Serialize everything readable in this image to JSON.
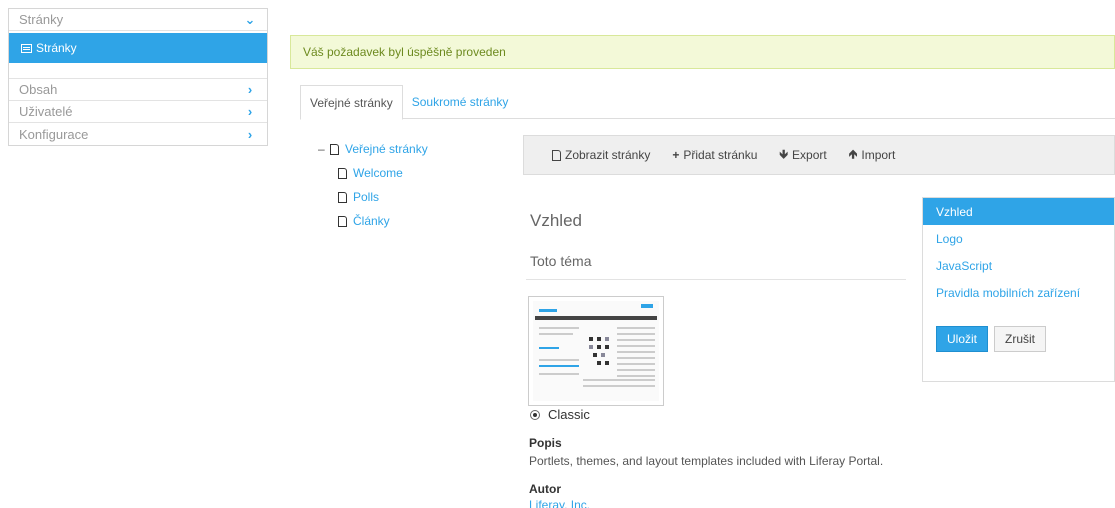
{
  "sidebar": {
    "sections": [
      {
        "label": "Stránky",
        "icon": "chevron-down-icon"
      },
      {
        "label": "Obsah",
        "icon": "chevron-right-icon"
      },
      {
        "label": "Uživatelé",
        "icon": "chevron-right-icon"
      },
      {
        "label": "Konfigurace",
        "icon": "chevron-right-icon"
      }
    ],
    "active_sub_item": "Stránky"
  },
  "alert": {
    "message": "Váš požadavek byl úspěšně proveden"
  },
  "tabs": [
    {
      "label": "Veřejné stránky",
      "active": true
    },
    {
      "label": "Soukromé stránky",
      "active": false
    }
  ],
  "tree": {
    "root": {
      "toggle": "–",
      "label": "Veřejné stránky"
    },
    "children": [
      "Welcome",
      "Polls",
      "Články"
    ]
  },
  "toolbar": {
    "view_pages": "Zobrazit stránky",
    "add_page": "Přidat stránku",
    "export": "Export",
    "import": "Import"
  },
  "main": {
    "title": "Vzhled",
    "subtitle": "Toto téma",
    "theme_name": "Classic",
    "description_label": "Popis",
    "description": "Portlets, themes, and layout templates included with Liferay Portal.",
    "author_label": "Autor",
    "author": "Liferay, Inc."
  },
  "right_panel": {
    "items": [
      "Vzhled",
      "Logo",
      "JavaScript",
      "Pravidla mobilních zařízení"
    ],
    "active_item": "Vzhled",
    "save_label": "Uložit",
    "cancel_label": "Zrušit"
  },
  "colors": {
    "accent": "#2fa4e7",
    "alert_bg": "#f3f9d8",
    "alert_text": "#6d8a1f"
  }
}
